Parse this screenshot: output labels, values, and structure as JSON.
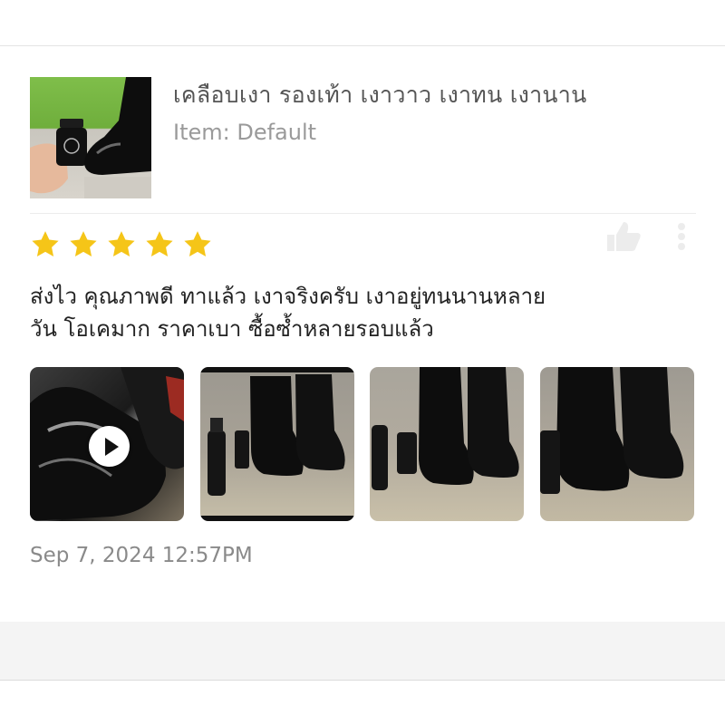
{
  "product": {
    "title": "เคลือบเงา รองเท้า เงาวาว เงาทน เงานาน",
    "variant": "Item: Default"
  },
  "review": {
    "rating": 5,
    "rating_max": 5,
    "star_color": "#f5c518",
    "text_line_1": "ส่งไว คุณภาพดี ทาแล้ว เงาจริงครับ เงาอยู่ทนนานหลาย",
    "text_line_2": "วัน โอเคมาก ราคาเบา ซื้อซ้ำหลายรอบแล้ว",
    "media": [
      {
        "kind": "video",
        "icon": "play-icon"
      },
      {
        "kind": "photo"
      },
      {
        "kind": "photo"
      },
      {
        "kind": "photo"
      }
    ],
    "timestamp": "Sep 7, 2024 12:57PM"
  },
  "icons": {
    "like": "thumbs-up-icon",
    "more": "more-options-icon",
    "play": "play-icon"
  }
}
